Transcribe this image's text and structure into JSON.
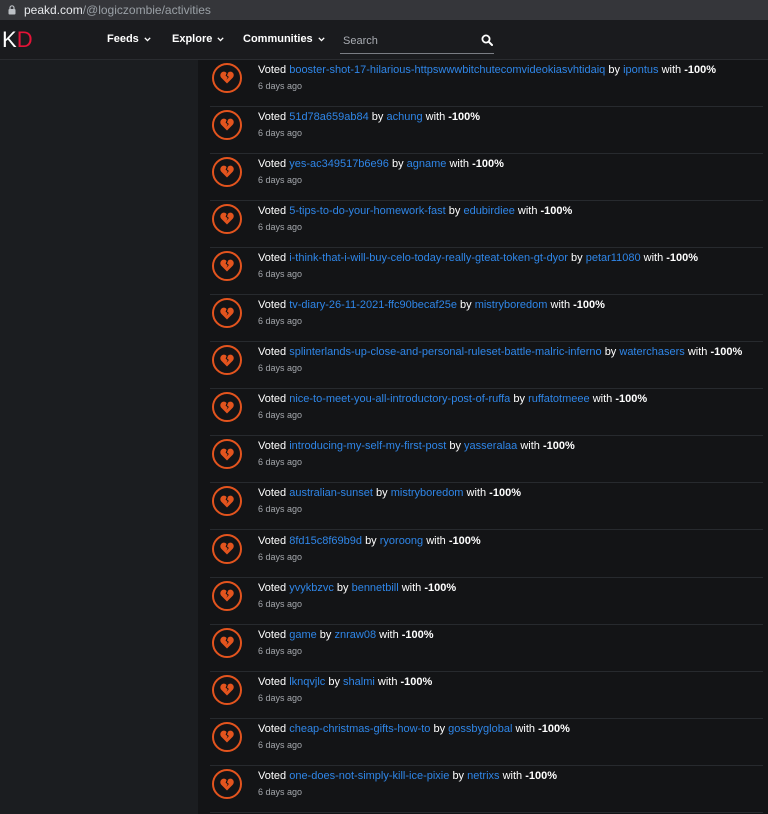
{
  "browser": {
    "host": "peakd.com",
    "path": "/@logiczombie/activities"
  },
  "nav": {
    "logo_k": "K",
    "logo_d": "D",
    "menu": [
      "Feeds",
      "Explore",
      "Communities"
    ],
    "search_placeholder": "Search"
  },
  "activities": [
    {
      "verb": "Voted",
      "post": "booster-shot-17-hilarious-httpswwwbitchutecomvideokiasvhtidaiq",
      "by": "by",
      "author": "ipontus",
      "with": "with",
      "weight": "-100%",
      "time": "6 days ago"
    },
    {
      "verb": "Voted",
      "post": "51d78a659ab84",
      "by": "by",
      "author": "achung",
      "with": "with",
      "weight": "-100%",
      "time": "6 days ago"
    },
    {
      "verb": "Voted",
      "post": "yes-ac349517b6e96",
      "by": "by",
      "author": "agname",
      "with": "with",
      "weight": "-100%",
      "time": "6 days ago"
    },
    {
      "verb": "Voted",
      "post": "5-tips-to-do-your-homework-fast",
      "by": "by",
      "author": "edubirdiee",
      "with": "with",
      "weight": "-100%",
      "time": "6 days ago"
    },
    {
      "verb": "Voted",
      "post": "i-think-that-i-will-buy-celo-today-really-gteat-token-gt-dyor",
      "by": "by",
      "author": "petar11080",
      "with": "with",
      "weight": "-100%",
      "time": "6 days ago"
    },
    {
      "verb": "Voted",
      "post": "tv-diary-26-11-2021-ffc90becaf25e",
      "by": "by",
      "author": "mistryboredom",
      "with": "with",
      "weight": "-100%",
      "time": "6 days ago"
    },
    {
      "verb": "Voted",
      "post": "splinterlands-up-close-and-personal-ruleset-battle-malric-inferno",
      "by": "by",
      "author": "waterchasers",
      "with": "with",
      "weight": "-100%",
      "time": "6 days ago"
    },
    {
      "verb": "Voted",
      "post": "nice-to-meet-you-all-introductory-post-of-ruffa",
      "by": "by",
      "author": "ruffatotmeee",
      "with": "with",
      "weight": "-100%",
      "time": "6 days ago"
    },
    {
      "verb": "Voted",
      "post": "introducing-my-self-my-first-post",
      "by": "by",
      "author": "yasseralaa",
      "with": "with",
      "weight": "-100%",
      "time": "6 days ago"
    },
    {
      "verb": "Voted",
      "post": "australian-sunset",
      "by": "by",
      "author": "mistryboredom",
      "with": "with",
      "weight": "-100%",
      "time": "6 days ago"
    },
    {
      "verb": "Voted",
      "post": "8fd15c8f69b9d",
      "by": "by",
      "author": "ryoroong",
      "with": "with",
      "weight": "-100%",
      "time": "6 days ago"
    },
    {
      "verb": "Voted",
      "post": "yvykbzvc",
      "by": "by",
      "author": "bennetbill",
      "with": "with",
      "weight": "-100%",
      "time": "6 days ago"
    },
    {
      "verb": "Voted",
      "post": "game",
      "by": "by",
      "author": "znraw08",
      "with": "with",
      "weight": "-100%",
      "time": "6 days ago"
    },
    {
      "verb": "Voted",
      "post": "lknqvjlc",
      "by": "by",
      "author": "shalmi",
      "with": "with",
      "weight": "-100%",
      "time": "6 days ago"
    },
    {
      "verb": "Voted",
      "post": "cheap-christmas-gifts-how-to",
      "by": "by",
      "author": "gossbyglobal",
      "with": "with",
      "weight": "-100%",
      "time": "6 days ago"
    },
    {
      "verb": "Voted",
      "post": "one-does-not-simply-kill-ice-pixie",
      "by": "by",
      "author": "netrixs",
      "with": "with",
      "weight": "-100%",
      "time": "6 days ago"
    }
  ],
  "colors": {
    "link": "#2f86e8",
    "downvote": "#e3541e",
    "brand": "#e31337"
  },
  "icons": {
    "lock": "lock-icon",
    "chevron": "chevron-down-icon",
    "search": "search-icon",
    "downvote": "broken-heart-icon"
  }
}
